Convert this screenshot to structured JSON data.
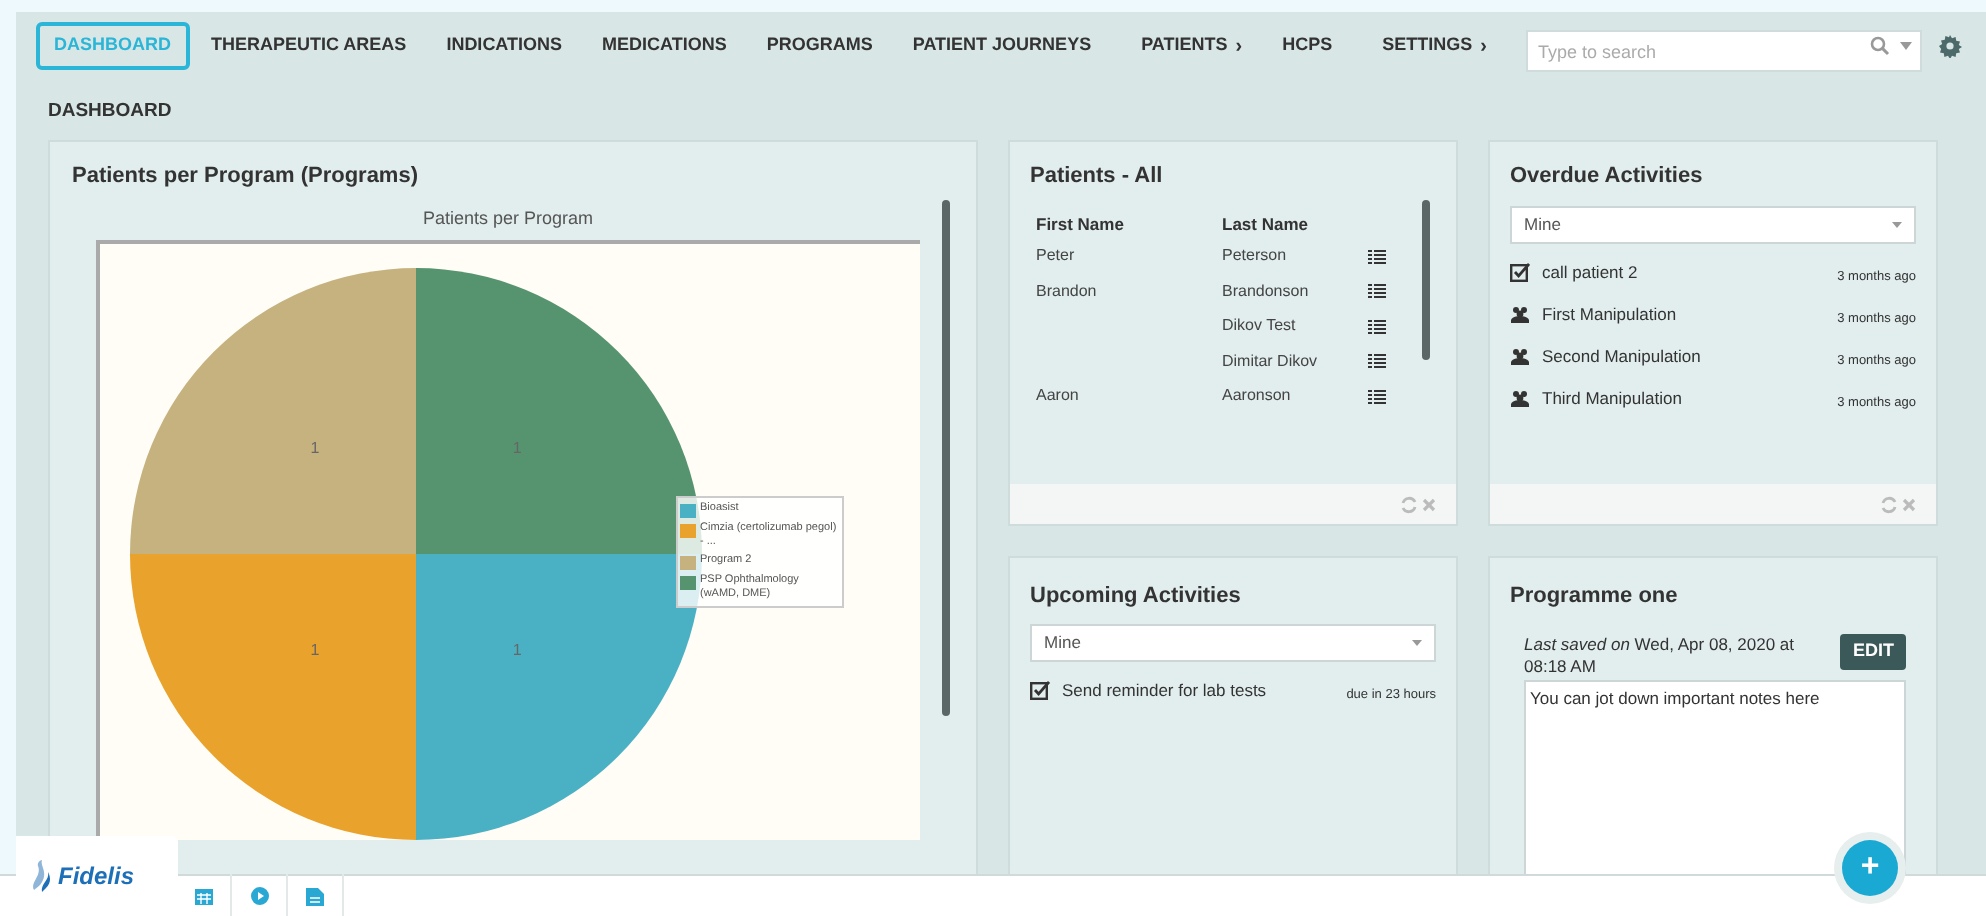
{
  "nav": [
    {
      "label": "DASHBOARD",
      "selected": true,
      "submenu": false
    },
    {
      "label": "THERAPEUTIC AREAS",
      "selected": false,
      "submenu": false
    },
    {
      "label": "INDICATIONS",
      "selected": false,
      "submenu": false
    },
    {
      "label": "MEDICATIONS",
      "selected": false,
      "submenu": false
    },
    {
      "label": "PROGRAMS",
      "selected": false,
      "submenu": false
    },
    {
      "label": "PATIENT JOURNEYS",
      "selected": false,
      "submenu": false
    },
    {
      "label": "PATIENTS",
      "selected": false,
      "submenu": true
    },
    {
      "label": "HCPS",
      "selected": false,
      "submenu": false
    },
    {
      "label": "SETTINGS",
      "selected": false,
      "submenu": true
    }
  ],
  "nav_submenu_marker": "›",
  "search": {
    "placeholder": "Type to search"
  },
  "page_title": "DASHBOARD",
  "chart_panel": {
    "title": "Patients per Program (Programs)",
    "chart_data": {
      "type": "pie",
      "title": "Patients per Program",
      "categories": [
        "Bioasist",
        "Cimzia (certolizumab pegol) - ...",
        "Program 2",
        "PSP Ophthalmology (wAMD, DME)"
      ],
      "series": [
        {
          "values": [
            1,
            1,
            1,
            1
          ]
        }
      ],
      "legend": "right",
      "colors": [
        "#4ab1c4",
        "#e9a22b",
        "#c5b27e",
        "#56946f"
      ],
      "data_labels": true
    }
  },
  "patients_panel": {
    "title": "Patients - All",
    "columns": [
      "First Name",
      "Last Name"
    ],
    "rows": [
      {
        "first_name": "Peter",
        "last_name": "Peterson"
      },
      {
        "first_name": "Brandon",
        "last_name": "Brandonson"
      },
      {
        "first_name": "",
        "last_name": "Dikov Test"
      },
      {
        "first_name": "",
        "last_name": "Dimitar Dikov"
      },
      {
        "first_name": "Aaron",
        "last_name": "Aaronson"
      }
    ]
  },
  "overdue_panel": {
    "title": "Overdue Activities",
    "filter": "Mine",
    "items": [
      {
        "kind": "task",
        "title": "call patient 2",
        "time": "3 months ago"
      },
      {
        "kind": "meeting",
        "title": "First Manipulation",
        "time": "3 months ago"
      },
      {
        "kind": "meeting",
        "title": "Second Manipulation",
        "time": "3 months ago"
      },
      {
        "kind": "meeting",
        "title": "Third Manipulation",
        "time": "3 months ago"
      }
    ]
  },
  "upcoming_panel": {
    "title": "Upcoming Activities",
    "filter": "Mine",
    "items": [
      {
        "kind": "task",
        "title": "Send reminder for lab tests",
        "time": "due in 23 hours"
      }
    ]
  },
  "notes_panel": {
    "title": "Programme one",
    "saved_text": "*Last saved on* Wed, Apr 08, 2020 at 08:18 AM",
    "edit_button": "EDIT",
    "notes": "You can jot down important notes here"
  },
  "fab": "+",
  "logo": "Fidelis"
}
